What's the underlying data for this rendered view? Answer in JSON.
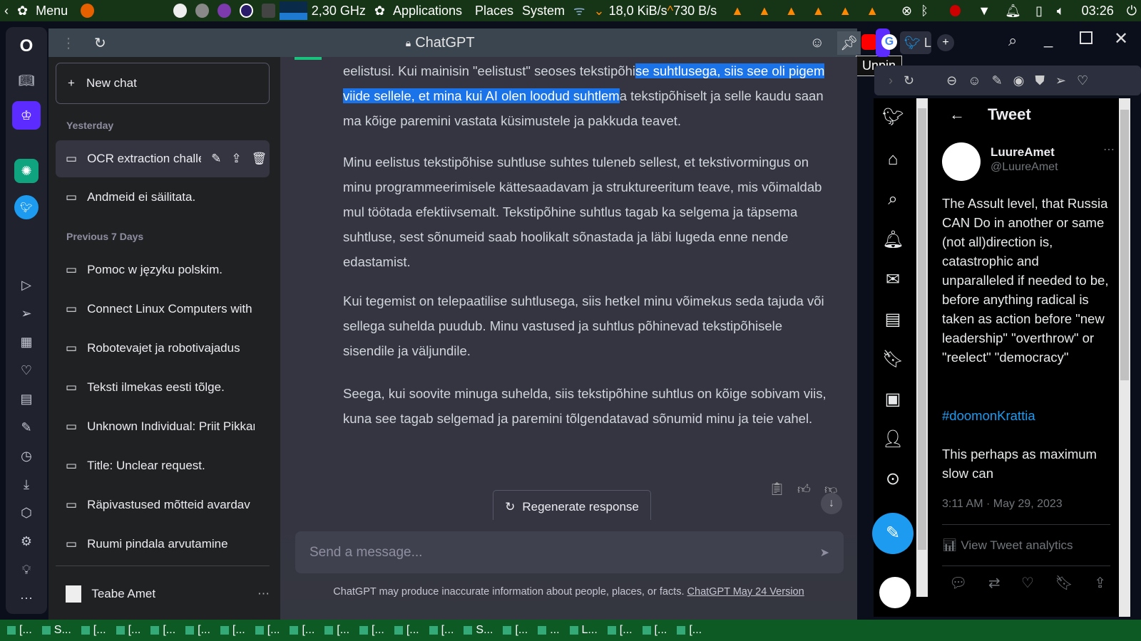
{
  "topbar": {
    "menu": "Menu",
    "cpu": "2,30 GHz",
    "applications": "Applications",
    "places": "Places",
    "system": "System",
    "down": "18,0 KiB/s",
    "up": "730 B/s",
    "clock": "03:26"
  },
  "taskbar": {
    "items": [
      "[...",
      "S...",
      "[...",
      "[...",
      "[...",
      "[...",
      "[...",
      "[...",
      "[...",
      "[...",
      "[...",
      "[...",
      "[...",
      "S...",
      "[...",
      "...",
      "L...",
      "[...",
      "[...",
      "[..."
    ]
  },
  "chatgpt": {
    "title": "ChatGPT",
    "new_chat": "New chat",
    "groups": [
      "Yesterday",
      "Previous 7 Days"
    ],
    "chats_yesterday": [
      "OCR extraction challenge",
      "Andmeid ei säilitata."
    ],
    "chats_week": [
      "Pomoc w języku polskim.",
      "Connect Linux Computers with",
      "Robotevajet ja robotivajadus",
      "Teksti ilmekas eesti tõlge.",
      "Unknown Individual: Priit Pikkar",
      "Title: Unclear request.",
      "Räpivastused mõtteid avardav",
      "Ruumi pindala arvutamine"
    ],
    "user": "Teabe Amet",
    "p1a": "eelistusi. Kui mainisin \"eelistust\" seoses tekstipõhi",
    "p1b": "se suhtlusega, siis see oli pigem viide sellele, et mina kui AI olen loodud suhtlem",
    "p1c": "a tekstipõhiselt ja selle kaudu saan ma kõige paremini vastata küsimustele ja pakkuda teavet.",
    "p2": "Minu eelistus tekstipõhise suhtluse suhtes tuleneb sellest, et tekstivormingus on minu programmeerimisele kättesaadavam ja struktureeritum teave, mis võimaldab mul töötada efektiivsemalt. Tekstipõhine suhtlus tagab ka selgema ja täpsema suhtluse, sest sõnumeid saab hoolikalt sõnastada ja läbi lugeda enne nende edastamist.",
    "p3": "Kui tegemist on telepaatilise suhtlusega, siis hetkel minu võimekus seda tajuda või sellega suhelda puudub. Minu vastused ja suhtlus põhinevad tekstipõhisele sisendile ja väljundile.",
    "p4": "Seega, kui soovite minuga suhelda, siis tekstipõhine suhtlus on kõige sobivam viis, kuna see tagab selgemad ja paremini tõlgendatavad sõnumid minu ja teie vahel.",
    "regenerate": "Regenerate response",
    "placeholder": "Send a message...",
    "disclaimer": "ChatGPT may produce inaccurate information about people, places, or facts. ",
    "version_link": "ChatGPT May 24 Version"
  },
  "tooltip": "Unpin",
  "tabs": {
    "twitter_label": "L"
  },
  "twitter": {
    "header": "Tweet",
    "name": "LuureAmet",
    "handle": "@LuureAmet",
    "text": "The Assult level, that Russia CAN Do in another or same (not all)direction is, catastrophic and unparalleled if needed to be,\nbefore anything radical is taken as action before \"new leadership\" \"overthrow\" or \"reelect\" \"democracy\"",
    "hashtag": "#doomonKrattia",
    "text2": "This perhaps as maximum slow can",
    "time": "3:11 AM · May 29, 2023",
    "analytics": "View Tweet analytics"
  },
  "colors": {
    "highlight": "#1a73e8",
    "twitter_blue": "#1d9bf0",
    "opera_accent": "#5b2bff"
  }
}
